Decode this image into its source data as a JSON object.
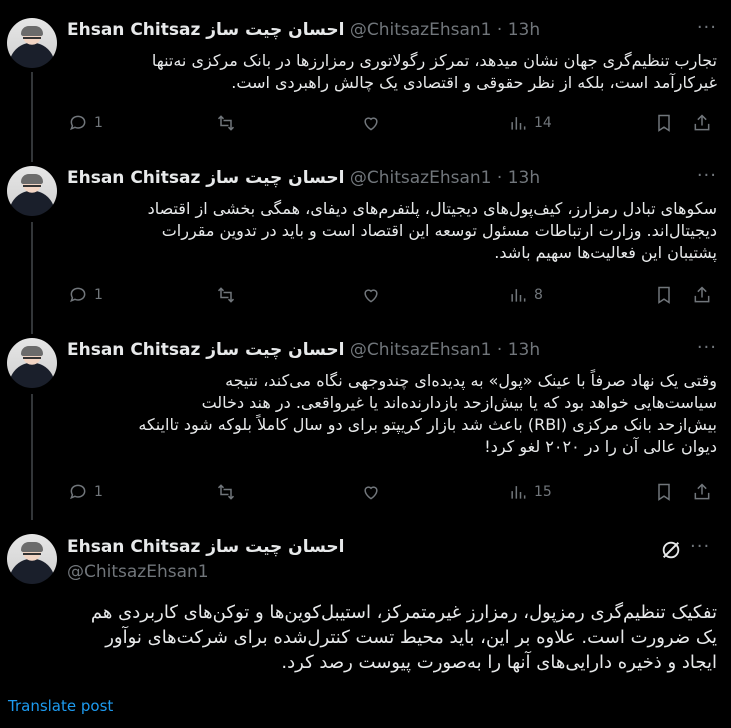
{
  "thread": [
    {
      "name": "Ehsan Chitsaz احسان چیت ساز",
      "handle": "@ChitsazEhsan1",
      "separator": "·",
      "time": "13h",
      "text_lines": [
        "تجارب تنظیم‌گری جهان نشان میدهد، تمرکز رگولاتوری رمزارزها در بانک مرکزی نه‌تنها",
        "غیرکارآمد است، بلکه از نظر حقوقی و اقتصادی یک چالش راهبردی است."
      ],
      "replies": "1",
      "views": "14"
    },
    {
      "name": "Ehsan Chitsaz احسان چیت ساز",
      "handle": "@ChitsazEhsan1",
      "separator": "·",
      "time": "13h",
      "text_lines": [
        "سکوهای تبادل رمزارز، کیف‌پول‌های دیجیتال، پلتفرم‌های دیفای، همگی بخشی از اقتصاد",
        "دیجیتال‌اند. وزارت ارتباطات مسئول توسعه این اقتصاد است و باید در تدوین مقررات",
        "پشتیبان این فعالیت‌ها سهیم باشد."
      ],
      "replies": "1",
      "views": "8"
    },
    {
      "name": "Ehsan Chitsaz احسان چیت ساز",
      "handle": "@ChitsazEhsan1",
      "separator": "·",
      "time": "13h",
      "text_lines": [
        "وقتی یک نهاد صرفاً با عینک «پول» به پدیده‌ای چندوجهی نگاه می‌کند، نتیجه",
        "سیاست‌هایی خواهد بود که یا بیش‌ازحد بازدارنده‌اند یا غیرواقعی. در هند دخالت",
        "بیش‌ازحد بانک مرکزی (RBI) باعث شد بازار کریپتو برای دو سال کاملاً بلوکه شود تااینکه",
        "دیوان عالی آن را در ۲۰۲۰ لغو کرد!"
      ],
      "replies": "1",
      "views": "15"
    }
  ],
  "main": {
    "name": "Ehsan Chitsaz احسان چیت ساز",
    "handle": "@ChitsazEhsan1",
    "text_lines": [
      "تفکیک تنظیم‌گری رمزپول، رمزارز غیرمتمرکز، استیبل‌کوین‌ها و توکن‌های کاربردی هم",
      "یک ضرورت است. علاوه بر این، باید محیط تست کنترل‌شده برای شرکت‌های نوآور",
      "ایجاد و ذخیره دارایی‌های آنها را به‌صورت پیوست رصد کرد."
    ],
    "translate_label": "Translate post"
  },
  "icons": {
    "more": "more-dots-icon",
    "reply": "reply-icon",
    "retweet": "retweet-icon",
    "like": "like-icon",
    "views": "views-icon",
    "bookmark": "bookmark-icon",
    "share": "share-icon",
    "grok": "grok-icon"
  },
  "colors": {
    "background": "#000000",
    "text": "#e7e9ea",
    "muted": "#71767b",
    "link": "#1d9bf0",
    "divider": "#2f3336"
  }
}
